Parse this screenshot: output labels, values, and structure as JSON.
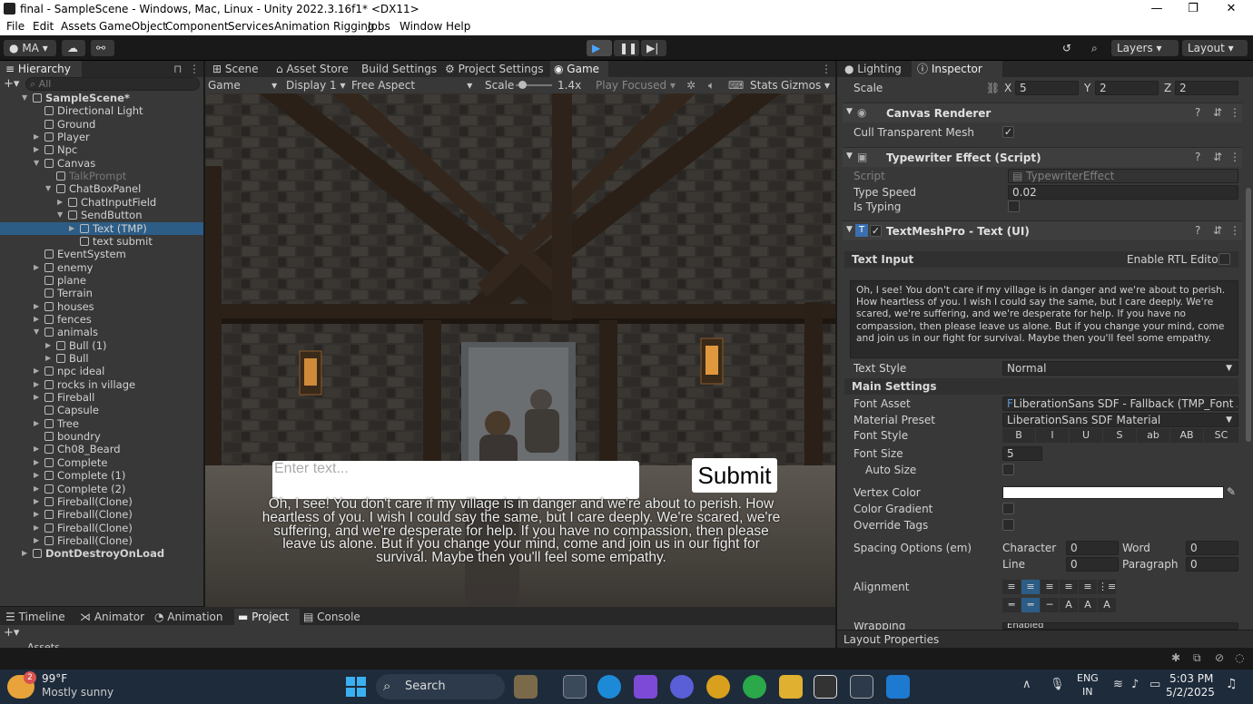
{
  "window": {
    "title": "final - SampleScene - Windows, Mac, Linux - Unity 2022.3.16f1* <DX11>",
    "min": "—",
    "max": "❐",
    "close": "✕"
  },
  "menu": [
    "File",
    "Edit",
    "Assets",
    "GameObject",
    "Component",
    "Services",
    "Animation Rigging",
    "Jobs",
    "Window",
    "Help"
  ],
  "toolbar": {
    "account": "MA",
    "layers": "Layers",
    "layout": "Layout"
  },
  "hierarchy": {
    "tab": "Hierarchy",
    "search_placeholder": "All",
    "items": [
      {
        "label": "SampleScene*",
        "depth": 0,
        "arrow": "▼",
        "bold": true
      },
      {
        "label": "Directional Light",
        "depth": 1,
        "arrow": ""
      },
      {
        "label": "Ground",
        "depth": 1,
        "arrow": ""
      },
      {
        "label": "Player",
        "depth": 1,
        "arrow": "▶"
      },
      {
        "label": "Npc",
        "depth": 1,
        "arrow": "▶"
      },
      {
        "label": "Canvas",
        "depth": 1,
        "arrow": "▼"
      },
      {
        "label": "TalkPrompt",
        "depth": 2,
        "arrow": "",
        "dim": true
      },
      {
        "label": "ChatBoxPanel",
        "depth": 2,
        "arrow": "▼"
      },
      {
        "label": "ChatInputField",
        "depth": 3,
        "arrow": "▶"
      },
      {
        "label": "SendButton",
        "depth": 3,
        "arrow": "▼"
      },
      {
        "label": "Text (TMP)",
        "depth": 4,
        "arrow": "▶",
        "selected": true
      },
      {
        "label": "text submit",
        "depth": 4,
        "arrow": ""
      },
      {
        "label": "EventSystem",
        "depth": 1,
        "arrow": ""
      },
      {
        "label": "enemy",
        "depth": 1,
        "arrow": "▶"
      },
      {
        "label": "plane",
        "depth": 1,
        "arrow": ""
      },
      {
        "label": "Terrain",
        "depth": 1,
        "arrow": ""
      },
      {
        "label": "houses",
        "depth": 1,
        "arrow": "▶"
      },
      {
        "label": "fences",
        "depth": 1,
        "arrow": "▶"
      },
      {
        "label": "animals",
        "depth": 1,
        "arrow": "▼"
      },
      {
        "label": "Bull (1)",
        "depth": 2,
        "arrow": "▶"
      },
      {
        "label": "Bull",
        "depth": 2,
        "arrow": "▶"
      },
      {
        "label": "npc ideal",
        "depth": 1,
        "arrow": "▶"
      },
      {
        "label": "rocks in village",
        "depth": 1,
        "arrow": "▶"
      },
      {
        "label": "Fireball",
        "depth": 1,
        "arrow": "▶"
      },
      {
        "label": "Capsule",
        "depth": 1,
        "arrow": ""
      },
      {
        "label": "Tree",
        "depth": 1,
        "arrow": "▶"
      },
      {
        "label": "boundry",
        "depth": 1,
        "arrow": ""
      },
      {
        "label": "Ch08_Beard",
        "depth": 1,
        "arrow": "▶"
      },
      {
        "label": "Complete",
        "depth": 1,
        "arrow": "▶"
      },
      {
        "label": "Complete (1)",
        "depth": 1,
        "arrow": "▶"
      },
      {
        "label": "Complete (2)",
        "depth": 1,
        "arrow": "▶"
      },
      {
        "label": "Fireball(Clone)",
        "depth": 1,
        "arrow": "▶"
      },
      {
        "label": "Fireball(Clone)",
        "depth": 1,
        "arrow": "▶"
      },
      {
        "label": "Fireball(Clone)",
        "depth": 1,
        "arrow": "▶"
      },
      {
        "label": "Fireball(Clone)",
        "depth": 1,
        "arrow": "▶"
      },
      {
        "label": "DontDestroyOnLoad",
        "depth": 0,
        "arrow": "▶",
        "bold": true
      }
    ]
  },
  "center_tabs": [
    "Scene",
    "Asset Store",
    "Build Settings",
    "Project Settings",
    "Game"
  ],
  "game_toolbar": {
    "mode": "Game",
    "display": "Display 1",
    "aspect": "Free Aspect",
    "scale_label": "Scale",
    "scale_value": "1.4x",
    "play_focused": "Play Focused",
    "stats": "Stats",
    "gizmos": "Gizmos"
  },
  "game": {
    "input_placeholder": "Enter text...",
    "submit": "Submit",
    "dialogue": "Oh, I see! You don't care if my village is in danger and we're about to perish. How heartless of you. I wish I could say the same, but I care deeply. We're scared, we're suffering, and we're desperate for help. If you have no compassion, then please leave us alone. But if you change your mind, come and join us in our fight for survival. Maybe then you'll feel some empathy."
  },
  "bottom_tabs": [
    "Timeline",
    "Animator",
    "Animation",
    "Project",
    "Console"
  ],
  "bottom_panel": {
    "assets_label": "Assets",
    "status": "Layout Properties"
  },
  "right_tabs": [
    "Lighting",
    "Inspector"
  ],
  "inspector": {
    "scale_label": "Scale",
    "scale_x": "5",
    "scale_y": "2",
    "scale_z": "2",
    "x": "X",
    "y": "Y",
    "z": "Z",
    "canvas_renderer": "Canvas Renderer",
    "cull_label": "Cull Transparent Mesh",
    "typewriter": "Typewriter Effect (Script)",
    "script_label": "Script",
    "script_value": "TypewriterEffect",
    "type_speed_label": "Type Speed",
    "type_speed": "0.02",
    "is_typing_label": "Is Typing",
    "tmp": "TextMeshPro - Text (UI)",
    "text_input": "Text Input",
    "rtl": "Enable RTL Editor",
    "text_value": "Oh, I see! You don't care if my village is in danger and we're about to perish. How heartless of you. I wish I could say the same, but I care deeply. We're scared, we're suffering, and we're desperate for help. If you have no compassion, then please leave us alone. But if you change your mind, come and join us in our fight for survival. Maybe then you'll feel some empathy.",
    "text_style_label": "Text Style",
    "text_style": "Normal",
    "main_settings": "Main Settings",
    "font_asset_label": "Font Asset",
    "font_asset": "LiberationSans SDF - Fallback (TMP_Font A:",
    "material_label": "Material Preset",
    "material": "LiberationSans SDF Material",
    "font_style_label": "Font Style",
    "font_style_buttons": [
      "B",
      "I",
      "U",
      "S",
      "ab",
      "AB",
      "SC"
    ],
    "font_size_label": "Font Size",
    "font_size": "5",
    "auto_size_label": "Auto Size",
    "vertex_color_label": "Vertex Color",
    "color_gradient_label": "Color Gradient",
    "override_tags_label": "Override Tags",
    "spacing_label": "Spacing Options (em)",
    "character_label": "Character",
    "character": "0",
    "word_label": "Word",
    "word": "0",
    "line_label": "Line",
    "line": "0",
    "paragraph_label": "Paragraph",
    "paragraph": "0",
    "alignment_label": "Alignment",
    "wrapping_label": "Wrapping",
    "wrapping": "Enabled"
  },
  "taskbar": {
    "temp": "99°F",
    "weather": "Mostly sunny",
    "badge": "2",
    "search": "Search",
    "lang1": "ENG",
    "lang2": "IN",
    "time": "5:03 PM",
    "date": "5/2/2025"
  },
  "colors": {
    "unity_dark": "#383838",
    "selection": "#2c5d87",
    "taskbar": "#1e2b3b"
  }
}
